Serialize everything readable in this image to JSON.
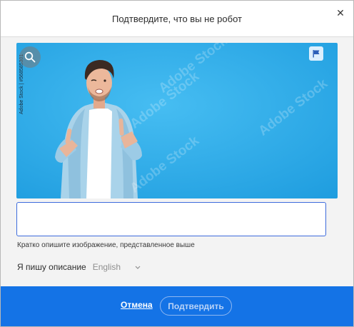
{
  "dialog": {
    "title": "Подтвердите, что вы не робот",
    "close_icon": "close-icon"
  },
  "image": {
    "stock_id": "Adobe Stock | #568585301",
    "watermark": "Adobe Stock",
    "zoom_icon": "search-icon",
    "flag_icon": "flag-icon"
  },
  "form": {
    "description_value": "",
    "description_placeholder": "",
    "hint": "Кратко опишите изображение, представленное выше",
    "language_label": "Я пишу описание",
    "language_value": "English"
  },
  "footer": {
    "cancel_label": "Отмена",
    "confirm_label": "Подтвердить"
  },
  "colors": {
    "accent": "#1473e6",
    "input_border": "#3d6bdc",
    "photo_background": "#2aa8e8"
  }
}
